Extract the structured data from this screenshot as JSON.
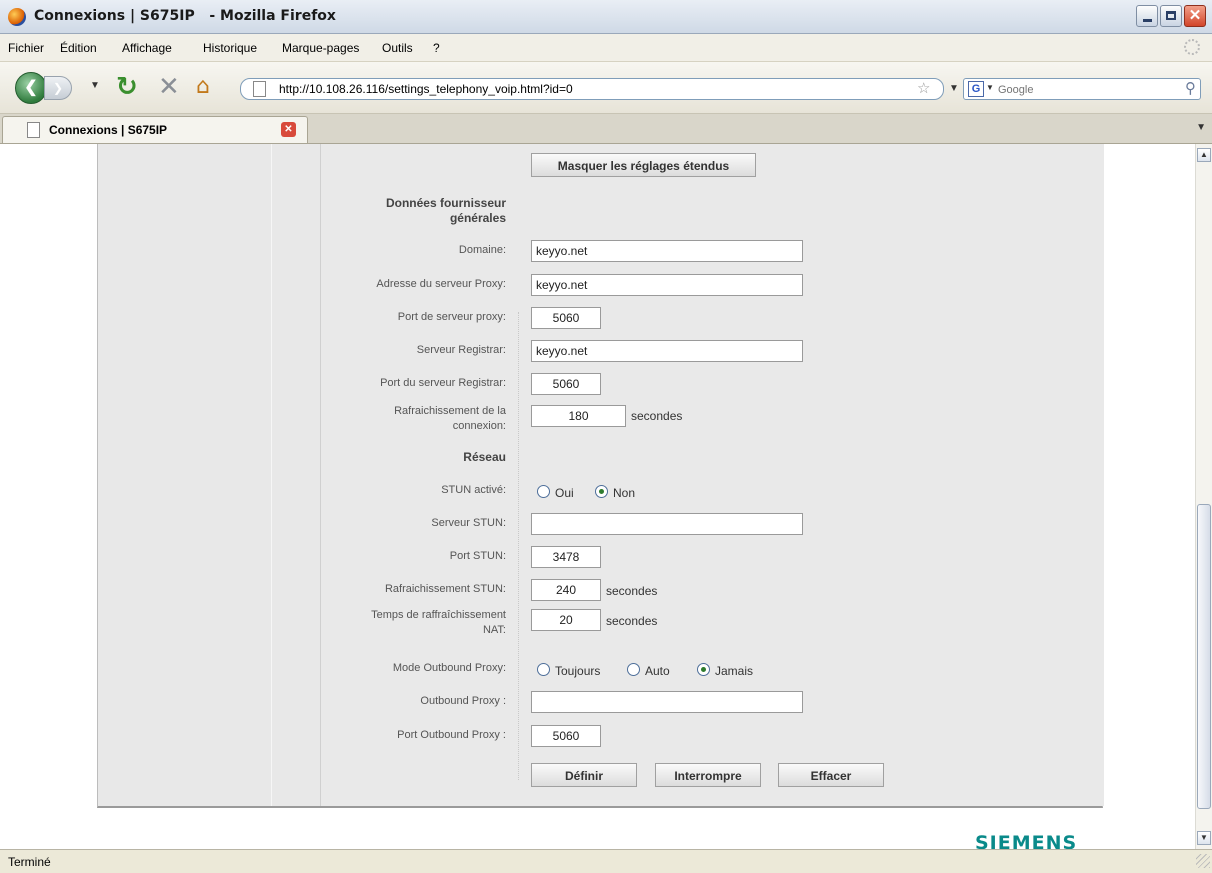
{
  "window": {
    "title": "Connexions | S675IP   - Mozilla Firefox"
  },
  "menu": [
    "Fichier",
    "Édition",
    "Affichage",
    "Historique",
    "Marque-pages",
    "Outils",
    "?"
  ],
  "nav": {
    "url": "http://10.108.26.116/settings_telephony_voip.html?id=0",
    "search_placeholder": "Google"
  },
  "tab": {
    "label": "Connexions | S675IP"
  },
  "form": {
    "toggle_button": "Masquer les réglages étendus",
    "section_provider": "Données fournisseur générales",
    "domain_label": "Domaine:",
    "domain_value": "keyyo.net",
    "proxy_label": "Adresse du serveur Proxy:",
    "proxy_value": "keyyo.net",
    "proxy_port_label": "Port de serveur proxy:",
    "proxy_port_value": "5060",
    "registrar_label": "Serveur Registrar:",
    "registrar_value": "keyyo.net",
    "registrar_port_label": "Port du serveur Registrar:",
    "registrar_port_value": "5060",
    "refresh_label": "Rafraichissement de la connexion:",
    "refresh_value": "180",
    "refresh_unit": "secondes",
    "section_network": "Réseau",
    "stun_enabled_label": "STUN activé:",
    "stun_yes": "Oui",
    "stun_no": "Non",
    "stun_selected": "Non",
    "stun_server_label": "Serveur STUN:",
    "stun_server_value": "",
    "stun_port_label": "Port STUN:",
    "stun_port_value": "3478",
    "stun_refresh_label": "Rafraichissement STUN:",
    "stun_refresh_value": "240",
    "stun_refresh_unit": "secondes",
    "nat_refresh_label": "Temps de raffraîchissement NAT:",
    "nat_refresh_value": "20",
    "nat_refresh_unit": "secondes",
    "outbound_mode_label": "Mode Outbound Proxy:",
    "outbound_always": "Toujours",
    "outbound_auto": "Auto",
    "outbound_never": "Jamais",
    "outbound_selected": "Jamais",
    "outbound_proxy_label": "Outbound Proxy :",
    "outbound_proxy_value": "",
    "outbound_port_label": "Port Outbound Proxy :",
    "outbound_port_value": "5060",
    "btn_define": "Définir",
    "btn_interrupt": "Interrompre",
    "btn_clear": "Effacer"
  },
  "brand": "SIEMENS",
  "status": "Terminé"
}
